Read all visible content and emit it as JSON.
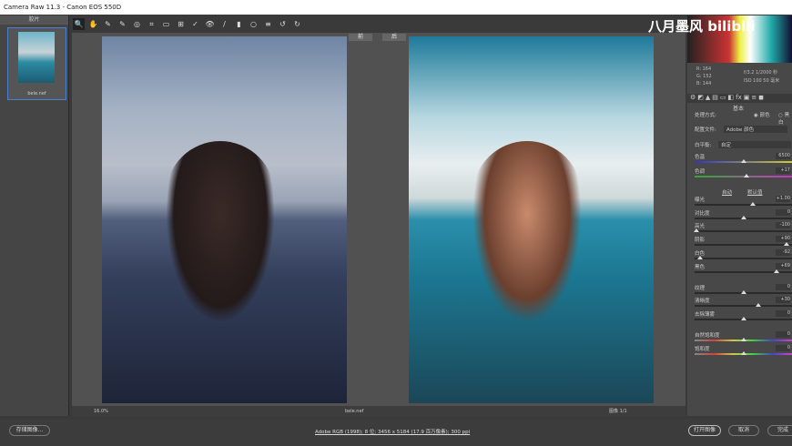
{
  "title": "Camera Raw 11.3 -  Canon EOS 550D",
  "filmstrip": {
    "header": "胶片",
    "file": "bele.nef"
  },
  "toolbar": [
    "🔍",
    "✋",
    "✎",
    "✎",
    "◎",
    "⌗",
    "▭",
    "⊞",
    "✓",
    "👁",
    "/",
    "▮",
    "○",
    "≡",
    "↺",
    "↻"
  ],
  "view_tags": {
    "before": "前",
    "after": "后"
  },
  "bottombar": {
    "zoom": "16.0%",
    "file": "bele.nef",
    "image_count": "图像 1/1"
  },
  "watermark": "八月墨风 bilibili",
  "readout": {
    "r": "R: 164",
    "g": "G: 152",
    "b": "B: 144",
    "exposure": "f/3.2  1/2000 秒",
    "iso": "ISO 100  50 毫米"
  },
  "panel": {
    "section": "基本",
    "treatment_label": "处理方式:",
    "treatment_color": "颜色",
    "treatment_bw": "黑白",
    "profile_label": "配置文件:",
    "profile_value": "Adobe 颜色",
    "wb_label": "白平衡:",
    "wb_value": "自定",
    "auto": "自动",
    "default": "默认值",
    "sliders": [
      {
        "label": "色温",
        "value": "6500",
        "pos": 0.5
      },
      {
        "label": "色调",
        "value": "+17",
        "pos": 0.53
      },
      {
        "label": "曝光",
        "value": "+1.00",
        "pos": 0.6
      },
      {
        "label": "对比度",
        "value": "0",
        "pos": 0.5
      },
      {
        "label": "高光",
        "value": "-100",
        "pos": 0.0
      },
      {
        "label": "阴影",
        "value": "+90",
        "pos": 0.95
      },
      {
        "label": "白色",
        "value": "-92",
        "pos": 0.04
      },
      {
        "label": "黑色",
        "value": "+69",
        "pos": 0.85
      },
      {
        "label": "纹理",
        "value": "0",
        "pos": 0.5
      },
      {
        "label": "清晰度",
        "value": "+30",
        "pos": 0.65
      },
      {
        "label": "去除薄雾",
        "value": "0",
        "pos": 0.5
      },
      {
        "label": "自然饱和度",
        "value": "0",
        "pos": 0.5
      },
      {
        "label": "饱和度",
        "value": "0",
        "pos": 0.5
      }
    ]
  },
  "footer": {
    "save": "存储图像...",
    "info": "Adobe RGB (1998); 8 位; 3456 x 5184 (17.9 百万像素); 300 ppi",
    "open": "打开图像",
    "cancel": "取消",
    "done": "完成"
  }
}
